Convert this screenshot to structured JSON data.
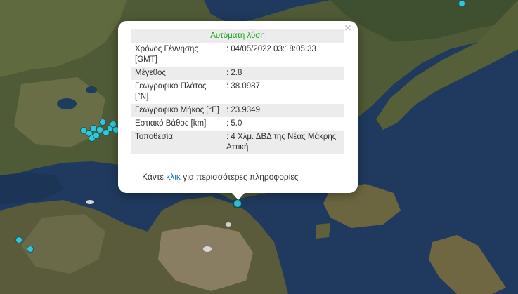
{
  "popup": {
    "title": "Αυτόματη λύση",
    "close_symbol": "×",
    "rows": [
      {
        "label": "Χρόνος Γέννησης [GMT]",
        "value": ": 04/05/2022 03:18:05.33"
      },
      {
        "label": "Μέγεθος",
        "value": ": 2.8"
      },
      {
        "label": "Γεωγραφικό Πλάτος [°N]",
        "value": ": 38.0987"
      },
      {
        "label": "Γεωγραφικό Μήκος [°E]",
        "value": ": 23.9349"
      },
      {
        "label": "Εστιακό Βάθος [km]",
        "value": ": 5.0"
      },
      {
        "label": "Τοποθεσία",
        "value": ": 4 Χλμ. ΔΒΔ της Νέας Μάκρης Αττική"
      }
    ],
    "footer_prefix": "Κάντε ",
    "footer_link": "κλικ",
    "footer_suffix": " για περισσότερες πληροφορίες"
  },
  "colors": {
    "marker_fill": "#35c6d6",
    "title_green": "#19a319",
    "link_blue": "#1f6fb8"
  }
}
